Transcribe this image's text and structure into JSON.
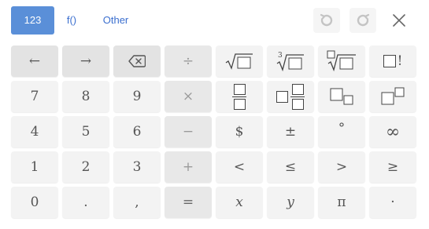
{
  "tabs": [
    {
      "label": "123",
      "active": true
    },
    {
      "label": "f()",
      "active": false
    },
    {
      "label": "Other",
      "active": false
    }
  ],
  "controls": {
    "undo": "undo-icon",
    "redo": "redo-icon",
    "close": "close-icon"
  },
  "keys": {
    "row1": {
      "left": "←",
      "right": "→",
      "backspace": "backspace-icon",
      "divide": "÷",
      "sqrt": "square-root-icon",
      "nthroot_index": "3",
      "nthroot": "cube-root-icon",
      "root_generic": "nth-root-icon",
      "factorial": "!"
    },
    "row2": {
      "seven": "7",
      "eight": "8",
      "nine": "9",
      "times": "×",
      "fraction": "fraction-icon",
      "mixed_fraction": "mixed-fraction-icon",
      "subscript": "subscript-icon",
      "superscript": "superscript-icon"
    },
    "row3": {
      "four": "4",
      "five": "5",
      "six": "6",
      "minus": "−",
      "dollar": "$",
      "plusminus": "±",
      "degree": "°",
      "infinity": "∞"
    },
    "row4": {
      "one": "1",
      "two": "2",
      "three": "3",
      "plus": "+",
      "lt": "<",
      "le": "≤",
      "gt": ">",
      "ge": "≥"
    },
    "row5": {
      "zero": "0",
      "dot": ".",
      "comma": ",",
      "equals": "=",
      "x": "x",
      "y": "y",
      "pi": "π",
      "cdot": "·"
    }
  },
  "colors": {
    "accent": "#5a8fd8",
    "tab_text": "#3b6fcf",
    "key_bg": "#f3f3f3",
    "key_dark": "#e3e3e3"
  }
}
